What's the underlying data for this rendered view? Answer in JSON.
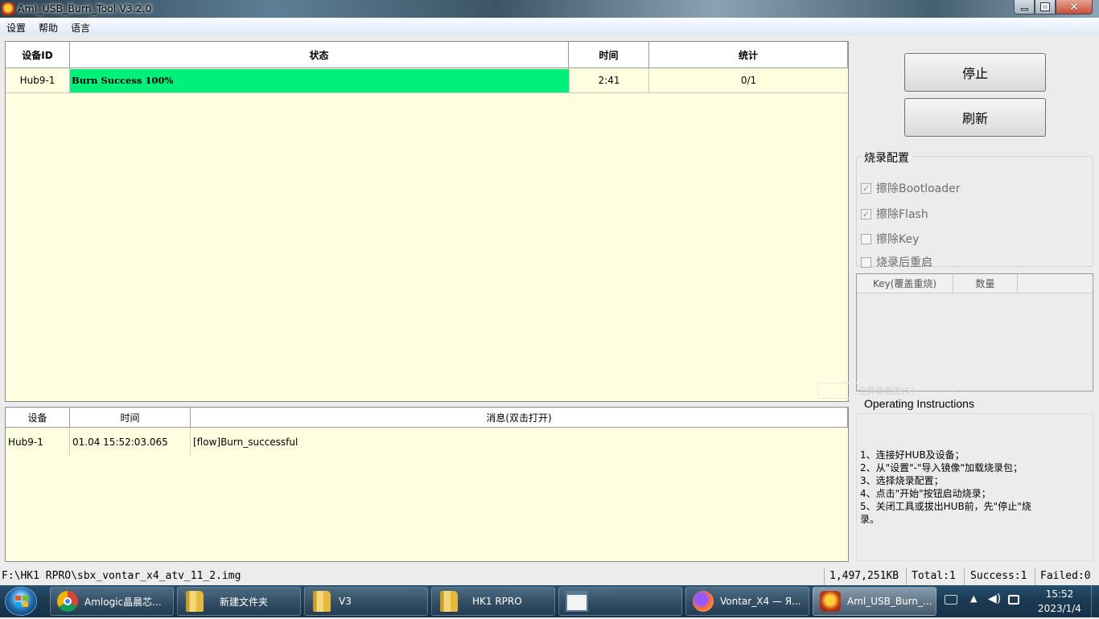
{
  "window": {
    "title": "Aml_USB_Burn_Tool V3.2.0"
  },
  "menu": [
    "设置",
    "帮助",
    "语言"
  ],
  "device_table": {
    "headers": [
      "设备ID",
      "状态",
      "时间",
      "统计"
    ],
    "rows": [
      {
        "id": "Hub9-1",
        "status": "Burn Success 100%",
        "time": "2:41",
        "stats": "0/1",
        "progress": 1.0
      }
    ]
  },
  "log_table": {
    "headers": [
      "设备",
      "时间",
      "消息(双击打开)"
    ],
    "rows": [
      {
        "device": "Hub9-1",
        "time": "01.04 15:52:03.065",
        "message": "[flow]Burn_successful"
      }
    ]
  },
  "buttons": {
    "stop": "停止",
    "refresh": "刷新"
  },
  "burn_config": {
    "title": "烧录配置",
    "options": [
      {
        "label": "擦除Bootloader",
        "checked": true
      },
      {
        "label": "擦除Flash",
        "checked": true
      },
      {
        "label": "擦除Key",
        "checked": false
      },
      {
        "label": "烧录后重启",
        "checked": false
      }
    ]
  },
  "key_table": {
    "headers": [
      "Key(覆盖重烧)",
      "数量"
    ]
  },
  "ghost_text": "全屏幕截图(S)",
  "instructions": {
    "title": "Operating Instructions",
    "lines": [
      "1、连接好HUB及设备；",
      "2、从\"设置\"-\"导入镜像\"加载烧录包；",
      "3、选择烧录配置；",
      "4、点击\"开始\"按钮启动烧录；",
      "5、关闭工具或拔出HUB前，先\"停止\"烧",
      "录。"
    ]
  },
  "statusbar": {
    "path": "F:\\HK1 RPRO\\sbx_vontar_x4_atv_11_2.img",
    "size": "1,497,251KB",
    "total": "Total:1",
    "success": "Success:1",
    "failed": "Failed:0"
  },
  "taskbar": {
    "items": [
      {
        "label": "Amlogic晶晨芯...",
        "icon": "chrome-icon"
      },
      {
        "label": "新建文件夹",
        "icon": "folder-icon"
      },
      {
        "label": "V3",
        "icon": "folder-icon"
      },
      {
        "label": "HK1 RPRO",
        "icon": "folder-icon"
      },
      {
        "label": "",
        "icon": "window-icon"
      },
      {
        "label": "Vontar_X4 — Я...",
        "icon": "firefox-icon"
      },
      {
        "label": "Aml_USB_Burn_...",
        "icon": "burn-tool-icon"
      }
    ],
    "clock_time": "15:52",
    "clock_date": "2023/1/4"
  },
  "colors": {
    "progress_fill": "#00f07a",
    "panel_bg": "#ffffe0",
    "taskbar": "#1c3a52"
  }
}
